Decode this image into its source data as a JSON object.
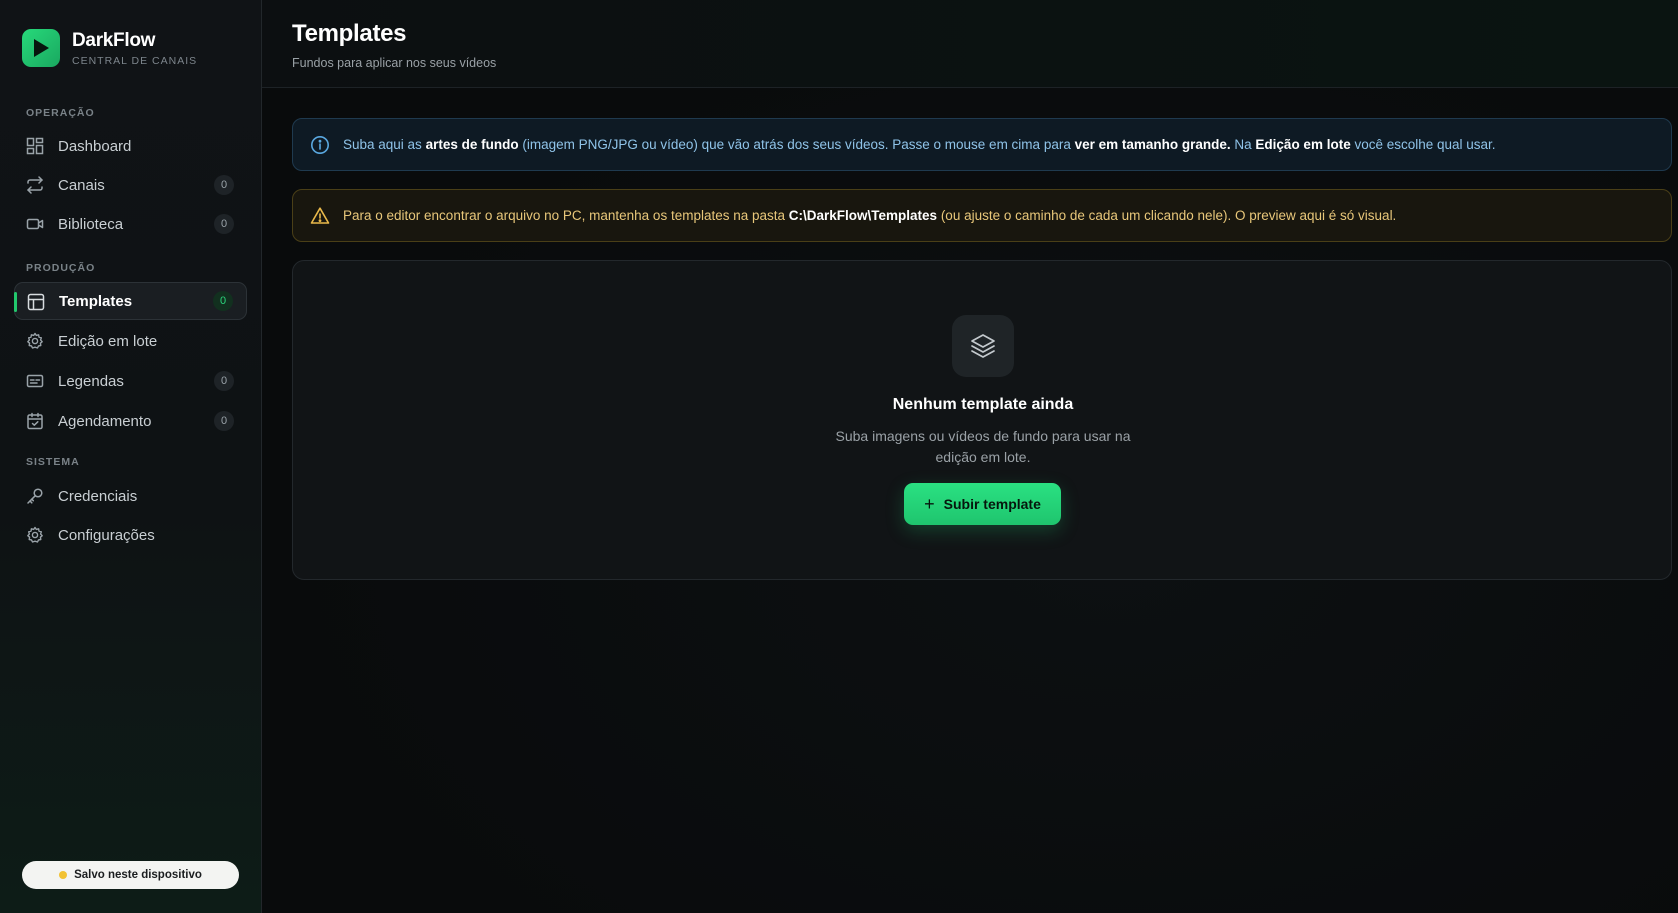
{
  "brand": {
    "name": "DarkFlow",
    "subtitle": "CENTRAL DE CANAIS"
  },
  "sidebar": {
    "sections": {
      "operacao": "OPERAÇÃO",
      "producao": "PRODUÇÃO",
      "sistema": "SISTEMA"
    },
    "items": {
      "dashboard": {
        "label": "Dashboard",
        "icon": "grid-icon"
      },
      "canais": {
        "label": "Canais",
        "badge": "0",
        "icon": "repeat-icon"
      },
      "biblioteca": {
        "label": "Biblioteca",
        "badge": "0",
        "icon": "video-icon"
      },
      "templates": {
        "label": "Templates",
        "badge": "0",
        "icon": "layout-icon",
        "active": true
      },
      "edicao": {
        "label": "Edição em lote",
        "icon": "gear-icon"
      },
      "legendas": {
        "label": "Legendas",
        "badge": "0",
        "icon": "subtitles-icon"
      },
      "agendamento": {
        "label": "Agendamento",
        "badge": "0",
        "icon": "calendar-icon"
      },
      "credenciais": {
        "label": "Credenciais",
        "icon": "key-icon"
      },
      "configuracoes": {
        "label": "Configurações",
        "icon": "settings-icon"
      }
    },
    "saved_status": "Salvo neste dispositivo"
  },
  "header": {
    "title": "Templates",
    "subtitle": "Fundos para aplicar nos seus vídeos"
  },
  "info_alert": {
    "t1": "Suba aqui as ",
    "b1": "artes de fundo",
    "t2": " (imagem PNG/JPG ou vídeo) que vão atrás dos seus vídeos. Passe o mouse em cima para ",
    "b2": "ver em tamanho grande.",
    "t3": " Na ",
    "b3": "Edição em lote",
    "t4": " você escolhe qual usar."
  },
  "warn_alert": {
    "t1": "Para o editor encontrar o arquivo no PC, mantenha os templates na pasta ",
    "b1": "C:\\DarkFlow\\Templates",
    "t2": " (ou ajuste o caminho de cada um clicando nele). O preview aqui é só visual."
  },
  "empty_state": {
    "title": "Nenhum template ainda",
    "description": "Suba imagens ou vídeos de fundo para usar na edição em lote.",
    "button_label": "Subir template"
  },
  "colors": {
    "accent": "#22c86d",
    "info": "#8fc3e8",
    "warning": "#e8c77a"
  }
}
